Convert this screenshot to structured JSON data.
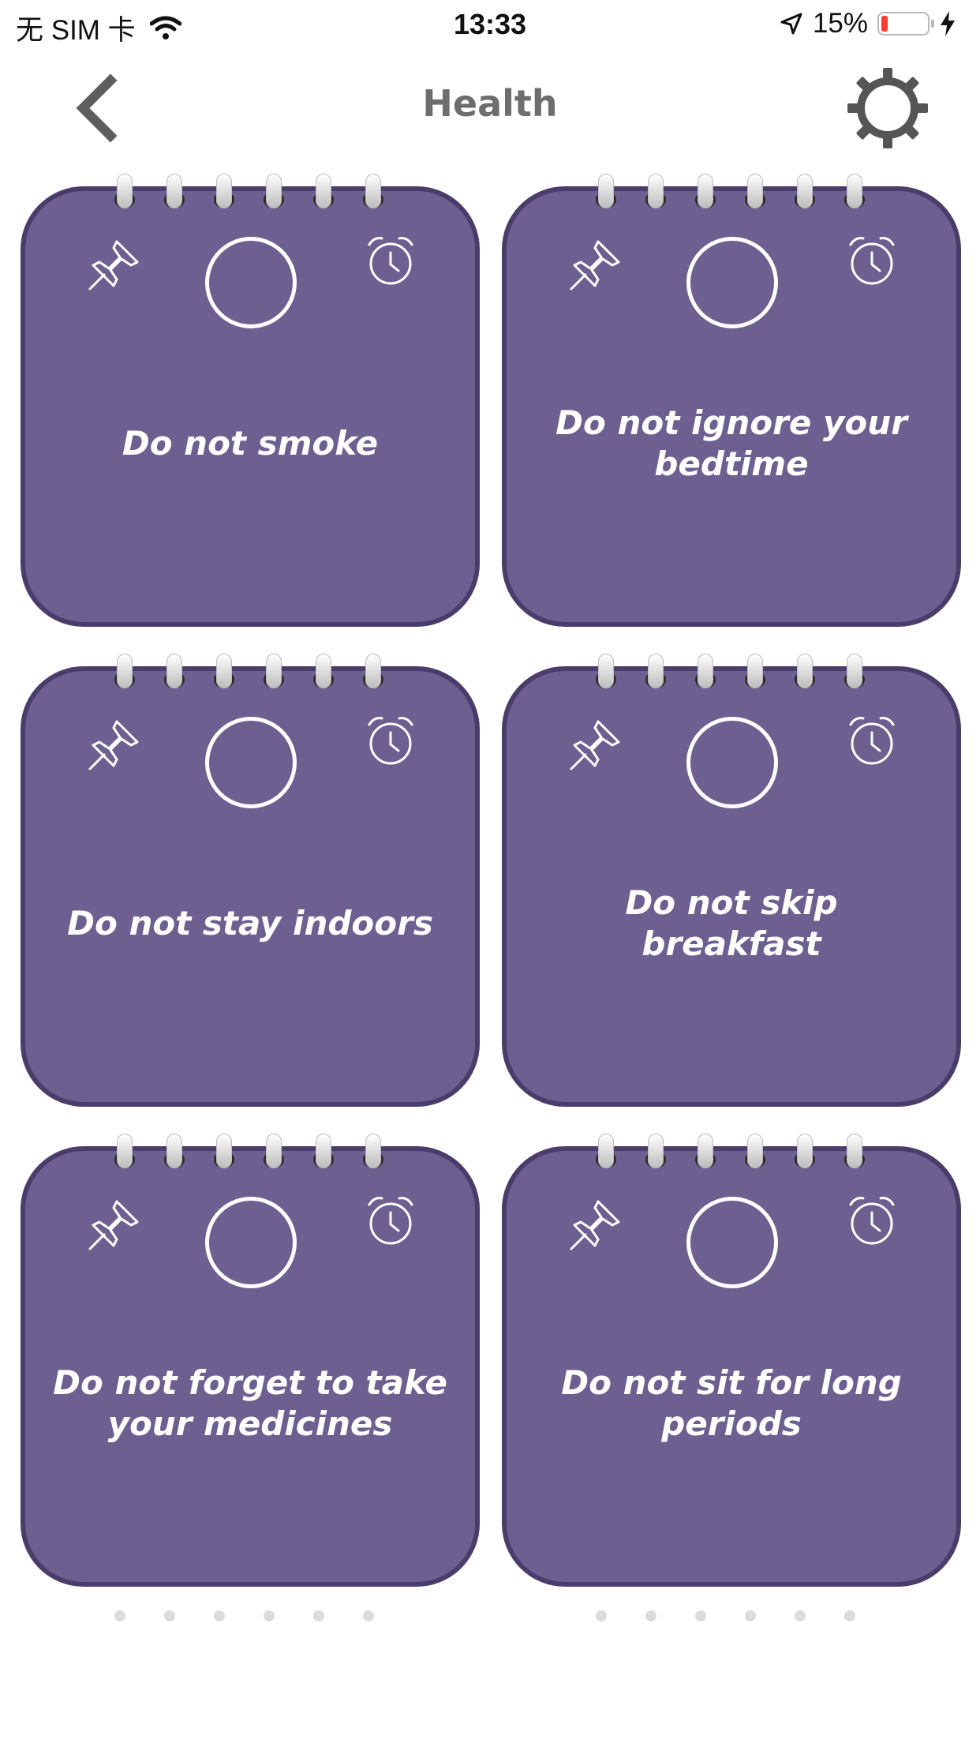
{
  "status_bar": {
    "carrier": "无 SIM 卡",
    "time": "13:33",
    "battery_percent": "15%",
    "battery_level": 0.15,
    "icons": [
      "wifi-icon",
      "location-arrow-icon",
      "battery-icon",
      "charging-bolt-icon"
    ]
  },
  "navbar": {
    "title": "Health",
    "back_icon": "chevron-left-icon",
    "settings_icon": "gear-icon"
  },
  "colors": {
    "card_fill": "#6d6090",
    "card_border": "#4a3d6b",
    "title_gray": "#6d6d6d"
  },
  "cards": [
    {
      "text": "Do not smoke",
      "checked": false
    },
    {
      "text": "Do not ignore your bedtime",
      "checked": false
    },
    {
      "text": "Do not stay indoors",
      "checked": false
    },
    {
      "text": "Do not skip breakfast",
      "checked": false
    },
    {
      "text": "Do not forget to take your medicines",
      "checked": false
    },
    {
      "text": "Do not sit for long periods",
      "checked": false
    }
  ]
}
